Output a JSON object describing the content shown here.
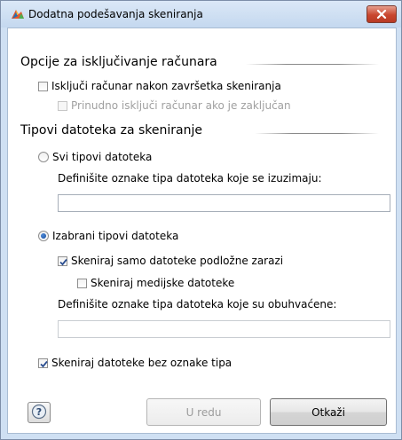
{
  "window": {
    "title": "Dodatna podešavanja skeniranja"
  },
  "shutdown_section": {
    "title": "Opcije za isključivanje računara",
    "shutdown_after_scan": {
      "label": "Isključi računar nakon završetka skeniranja",
      "checked": false
    },
    "force_shutdown_locked": {
      "label": "Prinudno isključi računar ako je zaključan",
      "checked": false,
      "disabled": true
    }
  },
  "file_types_section": {
    "title": "Tipovi datoteka za skeniranje",
    "all_types": {
      "label": "Svi tipovi datoteka",
      "selected": false
    },
    "excluded_ext_label": "Definišite oznake tipa datoteka koje se izuzimaju:",
    "excluded_ext_value": "",
    "selected_types": {
      "label": "Izabrani tipovi datoteka",
      "selected": true
    },
    "infectable_only": {
      "label": "Skeniraj samo datoteke podložne zarazi",
      "checked": true
    },
    "media_files": {
      "label": "Skeniraj medijske datoteke",
      "checked": false
    },
    "included_ext_label": "Definišite oznake tipa datoteka koje su obuhvaćene:",
    "included_ext_value": "",
    "no_extension": {
      "label": "Skeniraj datoteke bez oznake tipa",
      "checked": true
    }
  },
  "buttons": {
    "help_icon": "question-mark",
    "ok_label": "U redu",
    "cancel_label": "Otkaži"
  },
  "colors": {
    "titlebar": "#c4d8ef",
    "close": "#c9472f",
    "radio_selected": "#1b4f9c"
  }
}
